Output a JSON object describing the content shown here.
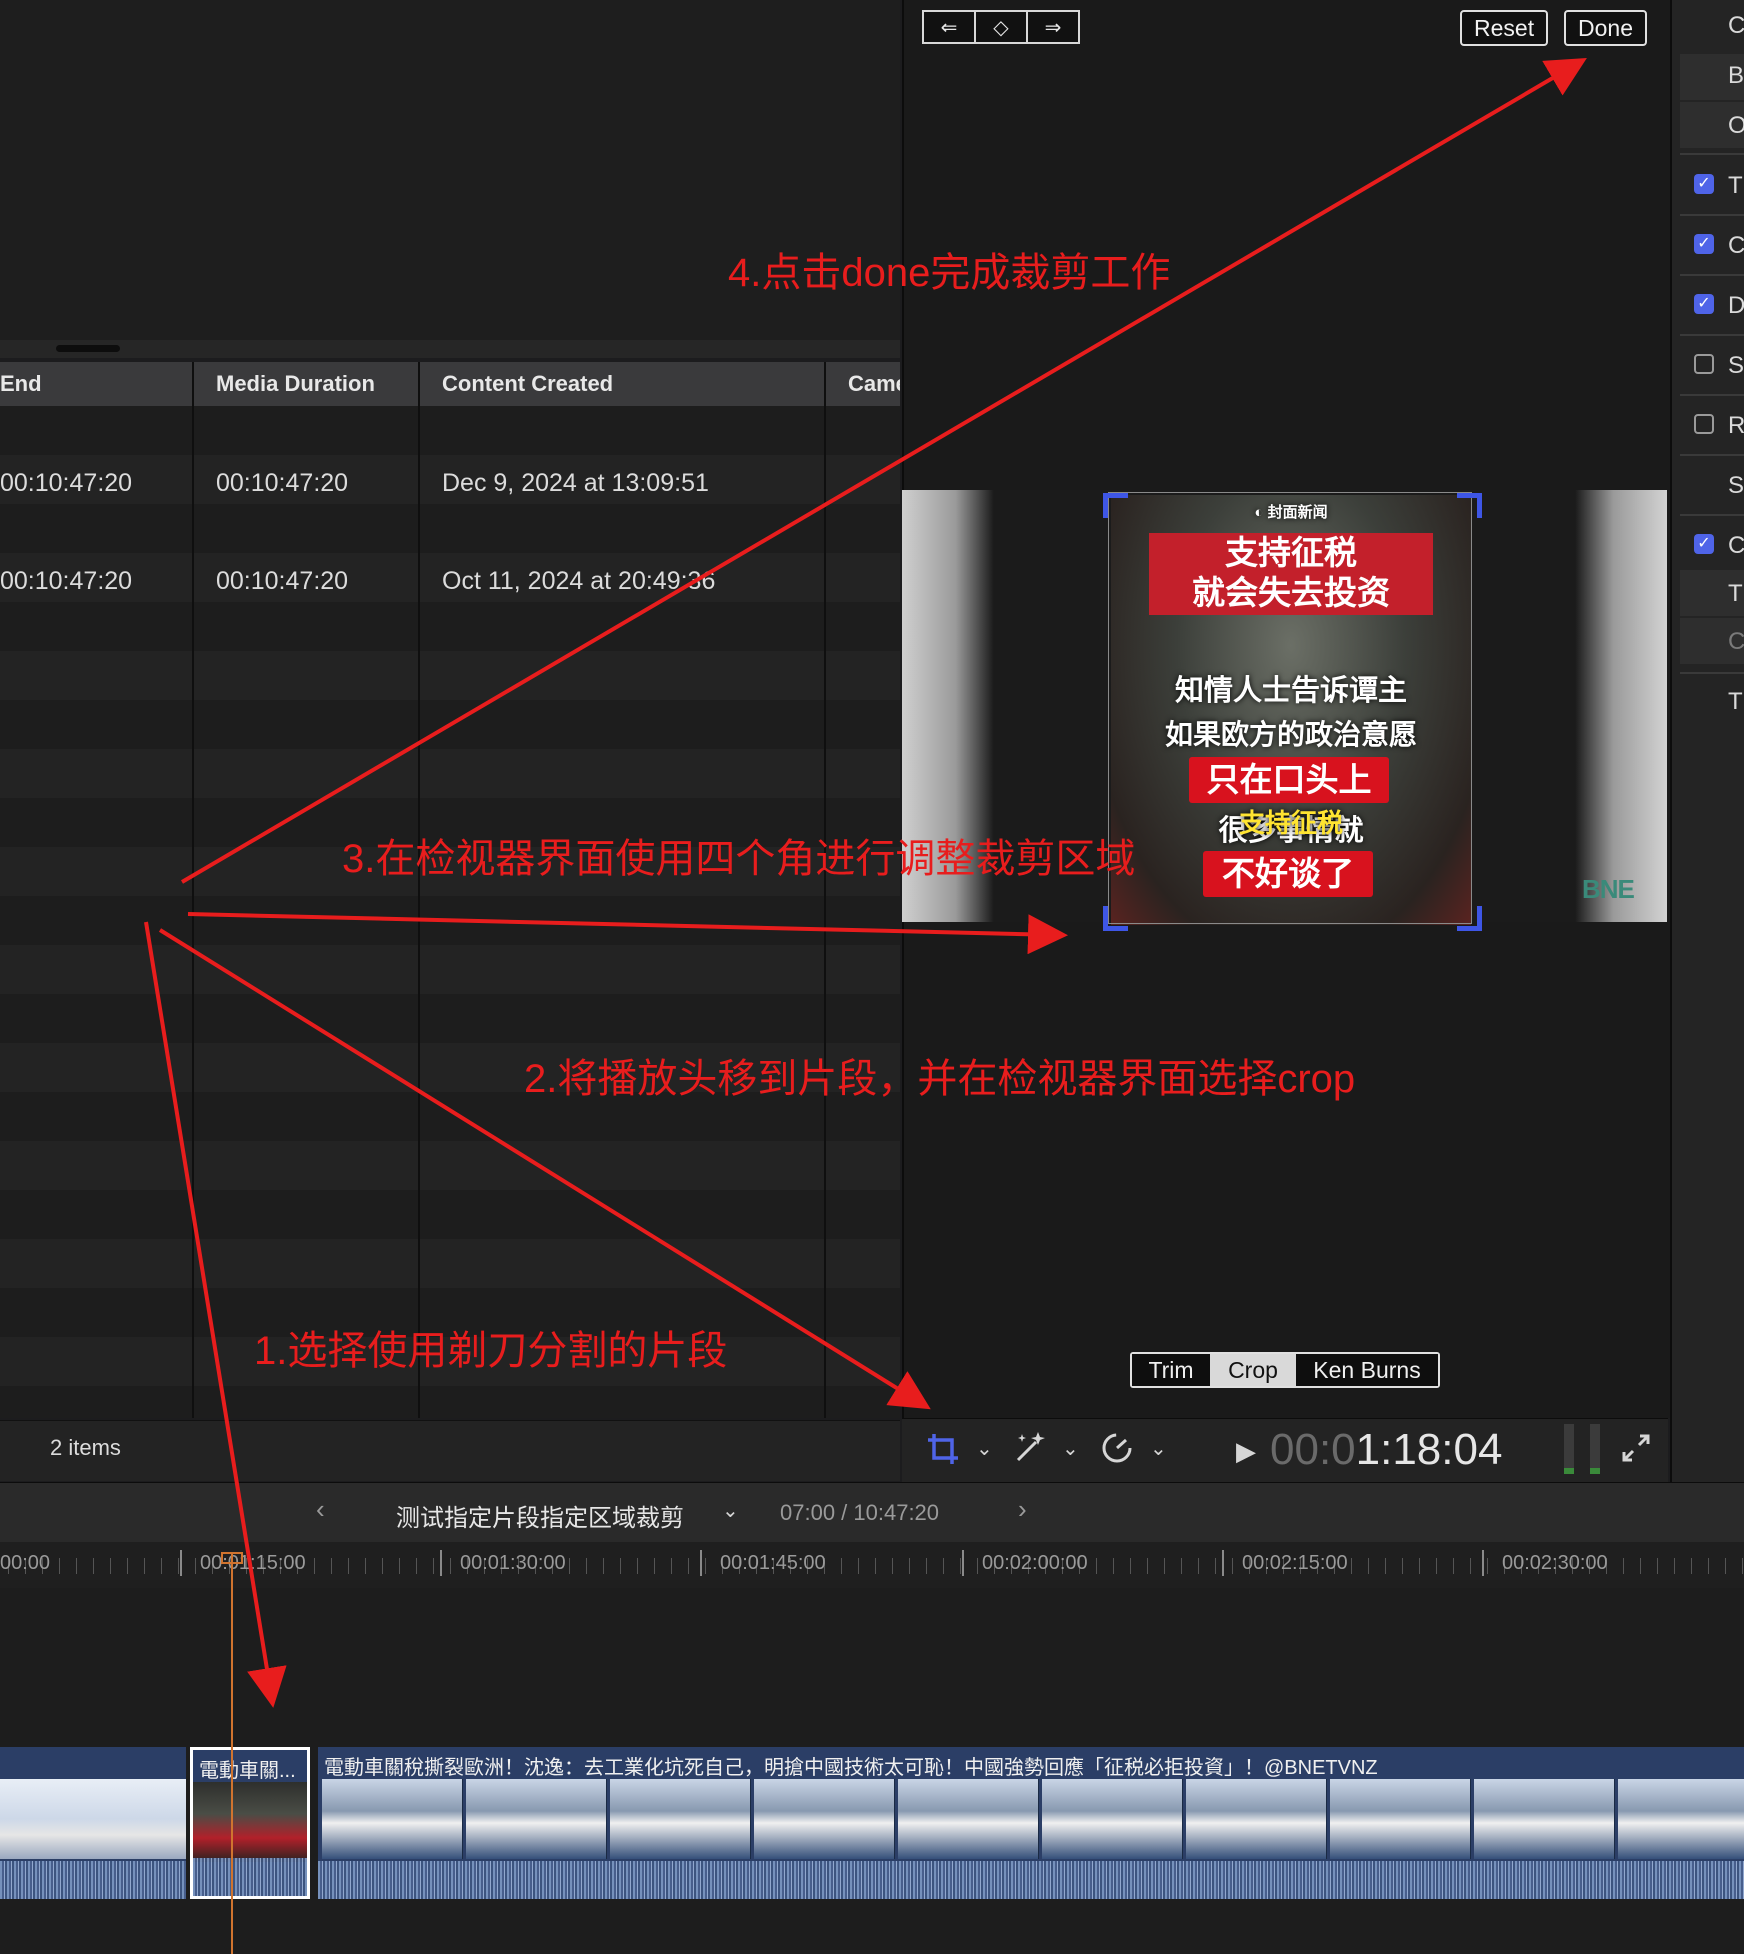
{
  "browser": {
    "columns": [
      "End",
      "Media Duration",
      "Content Created",
      "Came"
    ],
    "rows": [
      {
        "end": "00:10:47:20",
        "media_duration": "00:10:47:20",
        "content_created": "Dec 9, 2024 at 13:09:51"
      },
      {
        "end": "00:10:47:20",
        "media_duration": "00:10:47:20",
        "content_created": "Oct 11, 2024 at 20:49:36"
      }
    ],
    "items_count": "2 items"
  },
  "viewer": {
    "nav_prev": "⇐",
    "nav_keyframe": "◇",
    "nav_next": "⇒",
    "reset_label": "Reset",
    "done_label": "Done",
    "poster": {
      "logo": "◐ 封面新闻",
      "line1": "支持征税",
      "line2": "就会失去投资",
      "line3": "知情人士告诉谭主",
      "line4": "如果欧方的政治意愿",
      "line5": "只在口头上",
      "line6": "很多事情就",
      "highlight": "支持征税",
      "line7": "不好谈了"
    },
    "watermark": "BNE",
    "modes": [
      "Trim",
      "Crop",
      "Ken Burns"
    ],
    "active_mode": "Crop",
    "timecode_dim": "00:0",
    "timecode_bright": "1:18:04"
  },
  "inspector": {
    "rows": [
      {
        "letter": "C",
        "checkbox": "none"
      },
      {
        "letter": "B",
        "checkbox": "none"
      },
      {
        "letter": "O",
        "checkbox": "none"
      },
      {
        "letter": "T",
        "checkbox": "on"
      },
      {
        "letter": "C",
        "checkbox": "on"
      },
      {
        "letter": "D",
        "checkbox": "on"
      },
      {
        "letter": "S",
        "checkbox": "off"
      },
      {
        "letter": "R",
        "checkbox": "off"
      },
      {
        "letter": "S",
        "checkbox": "none"
      },
      {
        "letter": "C",
        "checkbox": "on"
      },
      {
        "letter": "T",
        "checkbox": "none"
      },
      {
        "letter": "C",
        "checkbox": "none"
      },
      {
        "letter": "T",
        "checkbox": "none"
      }
    ]
  },
  "timeline": {
    "project_name": "测试指定片段指定区域裁剪",
    "position": "07:00 / 10:47:20",
    "ticks": [
      "00:00",
      "00:01:15:00",
      "00:01:30:00",
      "00:01:45:00",
      "00:02:00:00",
      "00:02:15:00",
      "00:02:30:00"
    ],
    "clip_selected_title": "電動車關...",
    "clip_main_title": "電動車關稅撕裂歐洲！沈逸：去工業化坑死自己，明搶中國技術太可恥！中國強勢回應「征税必拒投資」！@BNETVNZ"
  },
  "annotations": {
    "step1": "1.选择使用剃刀分割的片段",
    "step2": "2.将播放头移到片段，并在检视器界面选择crop",
    "step3": "3.在检视器界面使用四个角进行调整裁剪区域",
    "step4": "4.点击done完成裁剪工作",
    "color": "#e81d1d"
  }
}
